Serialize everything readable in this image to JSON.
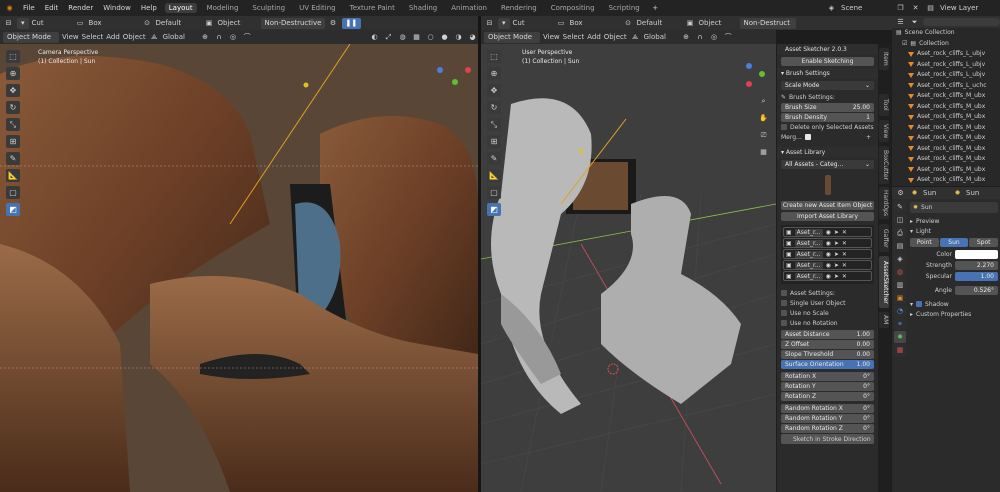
{
  "topbar": {
    "menus": [
      "File",
      "Edit",
      "Render",
      "Window",
      "Help"
    ],
    "workspaces": [
      "Layout",
      "Modeling",
      "Sculpting",
      "UV Editing",
      "Texture Paint",
      "Shading",
      "Animation",
      "Rendering",
      "Compositing",
      "Scripting"
    ],
    "active_workspace": "Layout",
    "scene_label": "Scene",
    "view_layer_label": "View Layer"
  },
  "viewport_left": {
    "tool_name": "Cut",
    "shape": "Box",
    "pivot": "Default",
    "snap_target": "Object",
    "mode_label": "Non-Destructive",
    "object_mode": "Object Mode",
    "menus": [
      "View",
      "Select",
      "Add",
      "Object"
    ],
    "orientation": "Global",
    "overlay_line1": "Camera Perspective",
    "overlay_line2": "(1) Collection | Sun"
  },
  "viewport_right": {
    "tool_name": "Cut",
    "shape": "Box",
    "pivot": "Default",
    "snap_target": "Object",
    "mode_label": "Non-Destruct",
    "object_mode": "Object Mode",
    "menus": [
      "View",
      "Select",
      "Add",
      "Object"
    ],
    "orientation": "Global",
    "overlay_line1": "User Perspective",
    "overlay_line2": "(1) Collection | Sun"
  },
  "asset_sketcher": {
    "title": "Asset Sketcher 2.0.3",
    "enable_button": "Enable Sketching",
    "brush_settings_title": "Brush Settings",
    "scale_mode": "Scale Mode",
    "brush_settings_label": "Brush Settings:",
    "brush_size_label": "Brush Size",
    "brush_size_value": "25.00",
    "brush_density_label": "Brush Density",
    "brush_density_value": "1",
    "delete_selected_label": "Delete only Selected Assets",
    "merge_label": "Merg...",
    "asset_library_title": "Asset Library",
    "library_dropdown": "All Assets - Categ...",
    "create_button": "Create new Asset Item Object",
    "import_button": "Import Asset Library",
    "assets": [
      "Aset_r...",
      "Aset_r...",
      "Aset_r...",
      "Aset_r...",
      "Aset_r..."
    ],
    "asset_settings_label": "Asset Settings:",
    "single_user_label": "Single User Object",
    "no_scale_label": "Use no Scale",
    "no_rotation_label": "Use no Rotation",
    "asset_distance_label": "Asset Distance",
    "asset_distance_value": "1.00",
    "z_offset_label": "Z Offset",
    "z_offset_value": "0.00",
    "slope_threshold_label": "Slope Threshold",
    "slope_threshold_value": "0.00",
    "surface_orientation_label": "Surface Orientation",
    "surface_orientation_value": "1.00",
    "rotation_x_label": "Rotation X",
    "rotation_y_label": "Rotation Y",
    "rotation_z_label": "Rotation Z",
    "rotation_value": "0°",
    "random_x_label": "Random Rotation X",
    "random_y_label": "Random Rotation Y",
    "random_z_label": "Random Rotation Z",
    "stroke_direction_label": "Sketch in Stroke Direction"
  },
  "sidebar_tabs": [
    "Item",
    "Tool",
    "View",
    "BoxCutter",
    "HardOps",
    "Gaffer",
    "AssetSketcher",
    "AM"
  ],
  "outliner": {
    "root": "Scene Collection",
    "collection": "Collection",
    "items": [
      "Aset_rock_cliffs_L_ubjv",
      "Aset_rock_cliffs_L_ubjv",
      "Aset_rock_cliffs_L_ubjv",
      "Aset_rock_cliffs_L_uchc",
      "Aset_rock_cliffs_M_ubx",
      "Aset_rock_cliffs_M_ubx",
      "Aset_rock_cliffs_M_ubx",
      "Aset_rock_cliffs_M_ubx",
      "Aset_rock_cliffs_M_ubx",
      "Aset_rock_cliffs_M_ubx",
      "Aset_rock_cliffs_M_ubx",
      "Aset_rock_cliffs_M_ubx",
      "Aset_rock_cliffs_M_ubx"
    ]
  },
  "properties": {
    "object_name": "Sun",
    "data_name": "Sun",
    "light_name": "Sun",
    "preview_label": "Preview",
    "light_label": "Light",
    "light_types": [
      "Point",
      "Sun",
      "Spot"
    ],
    "active_light_type": "Sun",
    "color_label": "Color",
    "strength_label": "Strength",
    "strength_value": "2.270",
    "specular_label": "Specular",
    "specular_value": "1.00",
    "angle_label": "Angle",
    "angle_value": "0.526°",
    "shadow_label": "Shadow",
    "custom_props_label": "Custom Properties"
  },
  "colors": {
    "accent": "#4772b3",
    "rock": "#7a4a2e",
    "clay": "#b9b9b9"
  }
}
